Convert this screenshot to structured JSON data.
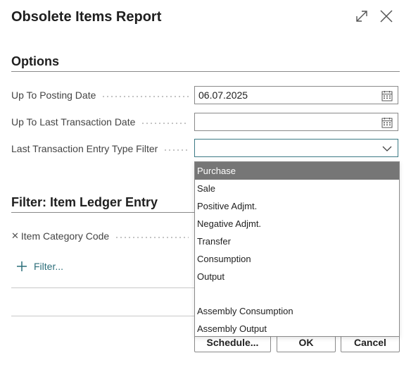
{
  "dialog": {
    "title": "Obsolete Items Report",
    "expand_icon": "expand-diagonal-icon",
    "close_icon": "close-icon"
  },
  "options": {
    "section_title": "Options",
    "fields": [
      {
        "label": "Up To Posting Date",
        "value": "06.07.2025",
        "icon": "calendar-icon"
      },
      {
        "label": "Up To Last Transaction Date",
        "value": "",
        "icon": "calendar-icon"
      },
      {
        "label": "Last Transaction Entry Type Filter",
        "value": "",
        "icon": "chevron-down-icon"
      }
    ]
  },
  "filter": {
    "section_title": "Filter: Item Ledger Entry",
    "fields": [
      {
        "label": "Item Category Code",
        "remove_icon": "remove-x-icon"
      }
    ],
    "add_filter_label": "Filter...",
    "add_icon": "plus-icon"
  },
  "dropdown": {
    "selected": "Purchase",
    "options": [
      "Purchase",
      "Sale",
      "Positive Adjmt.",
      "Negative Adjmt.",
      "Transfer",
      "Consumption",
      "Output",
      "",
      "Assembly Consumption",
      "Assembly Output"
    ]
  },
  "buttons": {
    "schedule": "Schedule...",
    "ok": "OK",
    "cancel": "Cancel"
  },
  "colors": {
    "accent": "#2c6e7a",
    "selected_bg": "#767676",
    "border": "#8a8a8a"
  }
}
